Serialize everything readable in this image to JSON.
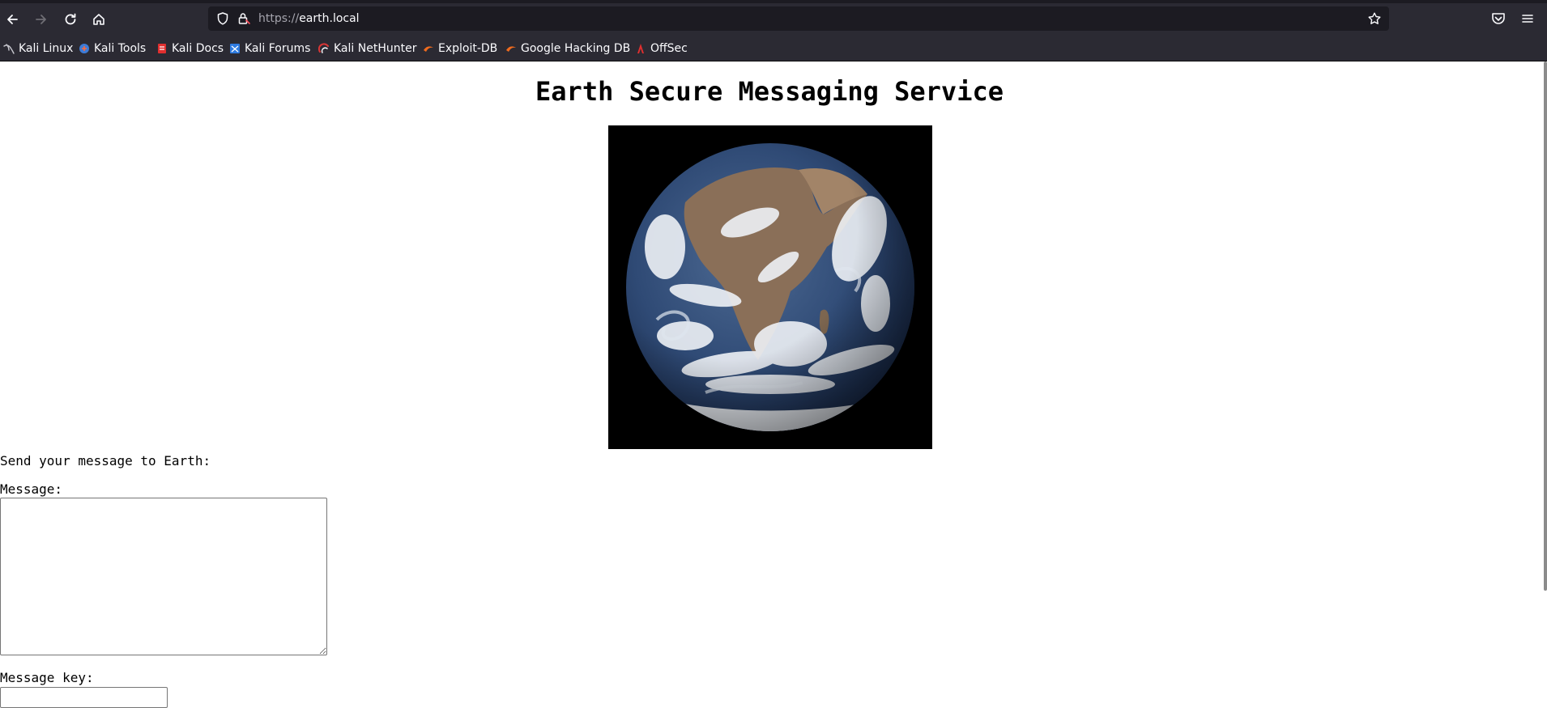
{
  "browser": {
    "url_protocol": "https://",
    "url_host": "earth.local",
    "bookmarks": [
      {
        "label": "Kali Linux",
        "icon": "kali-linux-icon",
        "color": "#367bf0"
      },
      {
        "label": "Kali Tools",
        "icon": "kali-tools-icon",
        "color": "#3e7bd6"
      },
      {
        "label": "Kali Docs",
        "icon": "kali-docs-icon",
        "color": "#e02f2f"
      },
      {
        "label": "Kali Forums",
        "icon": "kali-forums-icon",
        "color": "#2f7be0"
      },
      {
        "label": "Kali NetHunter",
        "icon": "kali-nethunter-icon",
        "color": "#d93636"
      },
      {
        "label": "Exploit-DB",
        "icon": "exploit-db-icon",
        "color": "#f06b1e"
      },
      {
        "label": "Google Hacking DB",
        "icon": "google-hacking-db-icon",
        "color": "#f06b1e"
      },
      {
        "label": "OffSec",
        "icon": "offsec-icon",
        "color": "#e02f2f"
      }
    ]
  },
  "page": {
    "title": "Earth Secure Messaging Service",
    "prompt": "Send your message to Earth:",
    "message_label": "Message:",
    "message_value": "",
    "key_label": "Message key:",
    "key_value": ""
  }
}
